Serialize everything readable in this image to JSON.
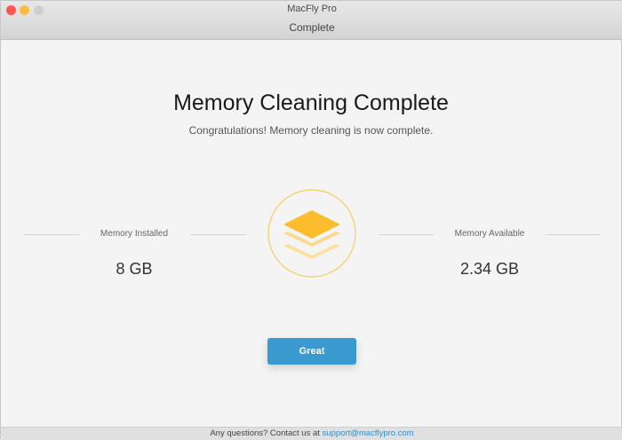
{
  "window": {
    "app_title": "MacFly Pro",
    "title": "Complete"
  },
  "main": {
    "heading": "Memory Cleaning Complete",
    "subtitle": "Congratulations! Memory cleaning is now complete.",
    "memory_installed": {
      "label": "Memory Installed",
      "value": "8 GB"
    },
    "memory_available": {
      "label": "Memory Available",
      "value": "2.34 GB"
    },
    "icon": "layers-icon",
    "great_button": "Great"
  },
  "footer": {
    "text": "Any questions? Contact us at",
    "email": "support@macflypro.com"
  },
  "colors": {
    "accent": "#3a9ad0",
    "icon": "#fbbd2c",
    "close": "#fc5753",
    "minimize": "#fdbc40",
    "zoom": "#cfcfcf"
  }
}
